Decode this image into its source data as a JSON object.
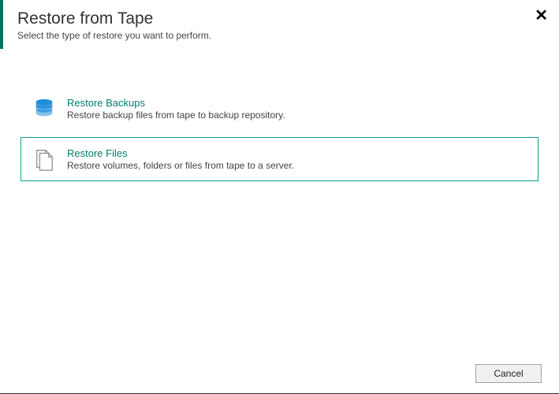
{
  "header": {
    "title": "Restore from Tape",
    "subtitle": "Select the type of restore you want to perform."
  },
  "options": [
    {
      "title": "Restore Backups",
      "desc": "Restore backup files from tape to backup repository."
    },
    {
      "title": "Restore Files",
      "desc": "Restore volumes, folders or files from tape to a server."
    }
  ],
  "footer": {
    "cancel": "Cancel"
  }
}
